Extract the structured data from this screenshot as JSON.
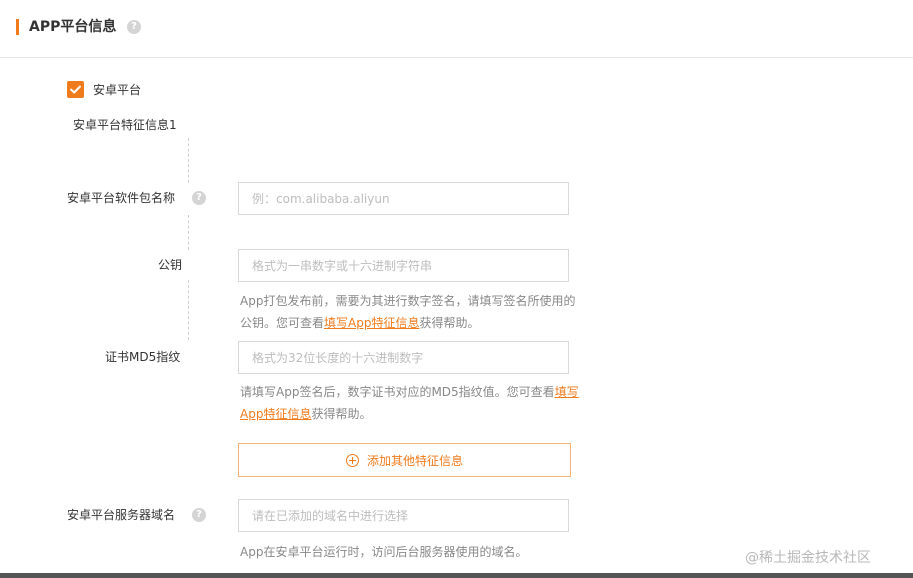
{
  "section": {
    "title": "APP平台信息",
    "help_glyph": "?"
  },
  "platform": {
    "checkbox_label": "安卓平台",
    "checked": true
  },
  "feature_group": {
    "title": "安卓平台特征信息1"
  },
  "fields": {
    "package_name": {
      "label": "安卓平台软件包名称",
      "placeholder": "例：com.alibaba.aliyun",
      "help_glyph": "?"
    },
    "public_key": {
      "label": "公钥",
      "placeholder": "格式为一串数字或十六进制字符串",
      "hint_before": "App打包发布前，需要为其进行数字签名，请填写签名所使用的公钥。您可查看",
      "hint_link": "填写App特征信息",
      "hint_after": "获得帮助。"
    },
    "cert_md5": {
      "label": "证书MD5指纹",
      "placeholder": "格式为32位长度的十六进制数字",
      "hint_before": "请填写App签名后，数字证书对应的MD5指纹值。您可查看",
      "hint_link": "填写App特征信息",
      "hint_after": "获得帮助。"
    },
    "server_domain": {
      "label": "安卓平台服务器域名",
      "placeholder": "请在已添加的域名中进行选择",
      "help_glyph": "?",
      "hint": "App在安卓平台运行时，访问后台服务器使用的域名。"
    }
  },
  "add_button": {
    "label": "添加其他特征信息",
    "icon": "plus-circle-icon"
  },
  "watermark": "@稀土掘金技术社区",
  "colors": {
    "accent": "#f07b1d",
    "border": "#d9d9d9",
    "placeholder": "#bdbdbd"
  }
}
